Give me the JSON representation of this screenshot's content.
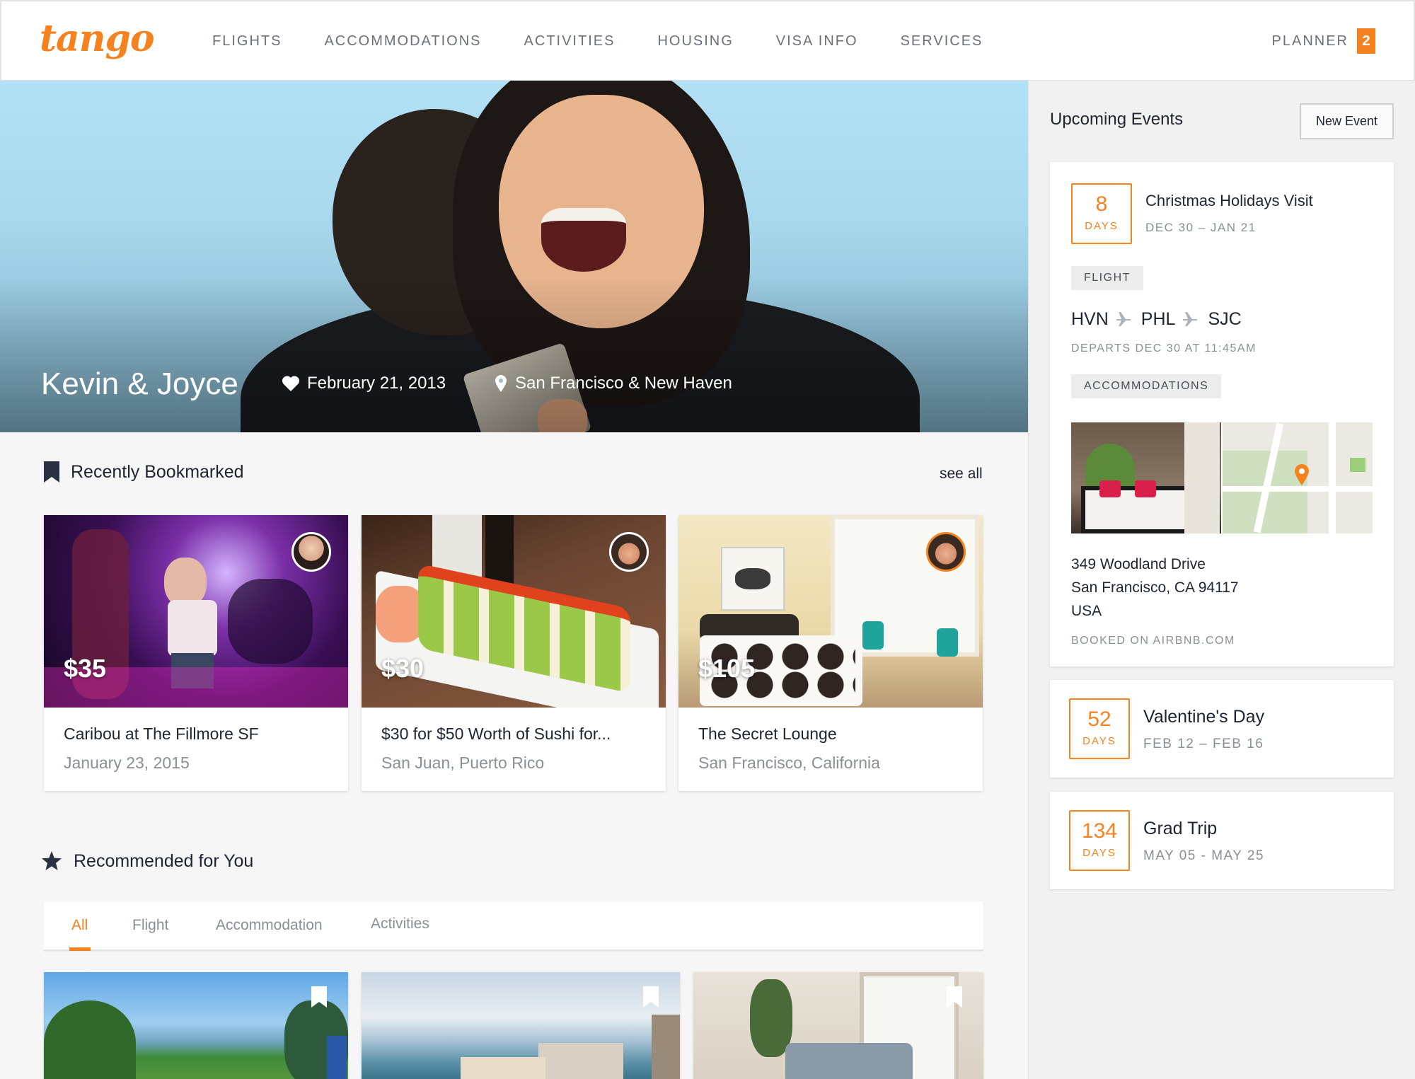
{
  "nav": {
    "logo": "tango",
    "items": [
      "FLIGHTS",
      "ACCOMMODATIONS",
      "ACTIVITIES",
      "HOUSING",
      "VISA INFO",
      "SERVICES"
    ],
    "planner_label": "PLANNER",
    "planner_count": "2"
  },
  "hero": {
    "title": "Kevin & Joyce",
    "date": "February 21, 2013",
    "location": "San Francisco & New Haven"
  },
  "bookmarked": {
    "heading": "Recently Bookmarked",
    "see_all": "see all",
    "cards": [
      {
        "price": "$35",
        "title": "Caribou at The Fillmore SF",
        "subtitle": "January 23, 2015"
      },
      {
        "price": "$30",
        "title": "$30 for $50 Worth of Sushi for...",
        "subtitle": "San Juan, Puerto Rico"
      },
      {
        "price": "$105",
        "title": "The Secret Lounge",
        "subtitle": "San Francisco, California"
      }
    ]
  },
  "recommended": {
    "heading": "Recommended for You",
    "tabs": [
      "All",
      "Flight",
      "Accommodation",
      "Activities"
    ],
    "active_tab": "All"
  },
  "sidebar": {
    "title": "Upcoming Events",
    "new_event": "New Event",
    "events": [
      {
        "days": "8",
        "days_label": "DAYS",
        "name": "Christmas Holidays Visit",
        "dates": "DEC 30 – JAN 21",
        "flight_tag": "FLIGHT",
        "route": [
          "HVN",
          "PHL",
          "SJC"
        ],
        "departs": "DEPARTS DEC 30 AT 11:45AM",
        "acc_tag": "ACCOMMODATIONS",
        "address": [
          "349 Woodland Drive",
          "San Francisco, CA 94117",
          "USA"
        ],
        "booked": "BOOKED ON AIRBNB.COM"
      },
      {
        "days": "52",
        "days_label": "DAYS",
        "name": "Valentine's Day",
        "dates": "FEB 12 – FEB 16"
      },
      {
        "days": "134",
        "days_label": "DAYS",
        "name": "Grad Trip",
        "dates": "MAY 05 - MAY 25"
      }
    ]
  },
  "colors": {
    "accent": "#f5821f",
    "text": "#1f2530",
    "muted": "#8a8f96"
  }
}
